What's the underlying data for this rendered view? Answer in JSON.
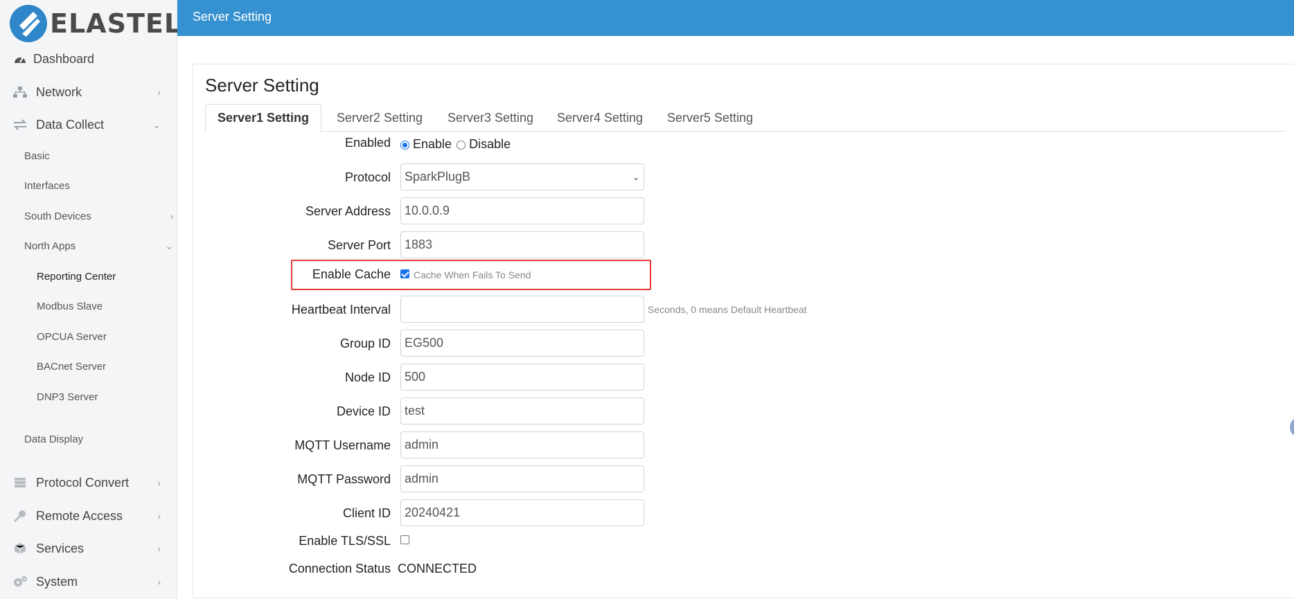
{
  "brand": {
    "name": "ELASTEL"
  },
  "header": {
    "title": "Server Setting"
  },
  "sidebar": {
    "items": [
      {
        "label": "Dashboard",
        "icon": "gauge-icon"
      },
      {
        "label": "Network",
        "icon": "network-icon"
      },
      {
        "label": "Data Collect",
        "icon": "arrows-icon"
      },
      {
        "label": "Basic"
      },
      {
        "label": "Interfaces"
      },
      {
        "label": "South Devices"
      },
      {
        "label": "North Apps"
      },
      {
        "label": "Reporting Center"
      },
      {
        "label": "Modbus Slave"
      },
      {
        "label": "OPCUA Server"
      },
      {
        "label": "BACnet Server"
      },
      {
        "label": "DNP3 Server"
      },
      {
        "label": "Data Display"
      },
      {
        "label": "Protocol Convert",
        "icon": "database-icon"
      },
      {
        "label": "Remote Access",
        "icon": "key-icon"
      },
      {
        "label": "Services",
        "icon": "cube-icon"
      },
      {
        "label": "System",
        "icon": "gears-icon"
      }
    ]
  },
  "main": {
    "title": "Server Setting",
    "tabs": [
      {
        "label": "Server1 Setting",
        "active": true
      },
      {
        "label": "Server2 Setting"
      },
      {
        "label": "Server3 Setting"
      },
      {
        "label": "Server4 Setting"
      },
      {
        "label": "Server5 Setting"
      }
    ],
    "form": {
      "enabled": {
        "label": "Enabled",
        "option_on": "Enable",
        "option_off": "Disable",
        "selected": "Enable"
      },
      "protocol": {
        "label": "Protocol",
        "value": "SparkPlugB"
      },
      "server_address": {
        "label": "Server Address",
        "value": "10.0.0.9"
      },
      "server_port": {
        "label": "Server Port",
        "value": "1883"
      },
      "enable_cache": {
        "label": "Enable Cache",
        "checked": true,
        "hint": "Cache When Fails To Send"
      },
      "heartbeat": {
        "label": "Heartbeat Interval",
        "value": "",
        "hint": "Seconds, 0 means Default Heartbeat"
      },
      "group_id": {
        "label": "Group ID",
        "value": "EG500"
      },
      "node_id": {
        "label": "Node ID",
        "value": "500"
      },
      "device_id": {
        "label": "Device ID",
        "value": "test"
      },
      "mqtt_username": {
        "label": "MQTT Username",
        "value": "admin"
      },
      "mqtt_password": {
        "label": "MQTT Password",
        "value": "admin"
      },
      "client_id": {
        "label": "Client ID",
        "value": "20240421"
      },
      "tls": {
        "label": "Enable TLS/SSL",
        "checked": false
      },
      "connection_status": {
        "label": "Connection Status",
        "value": "CONNECTED"
      }
    }
  },
  "colors": {
    "topbar": "#3591cf",
    "accent": "#1a73e8",
    "highlight": "#e53935"
  }
}
